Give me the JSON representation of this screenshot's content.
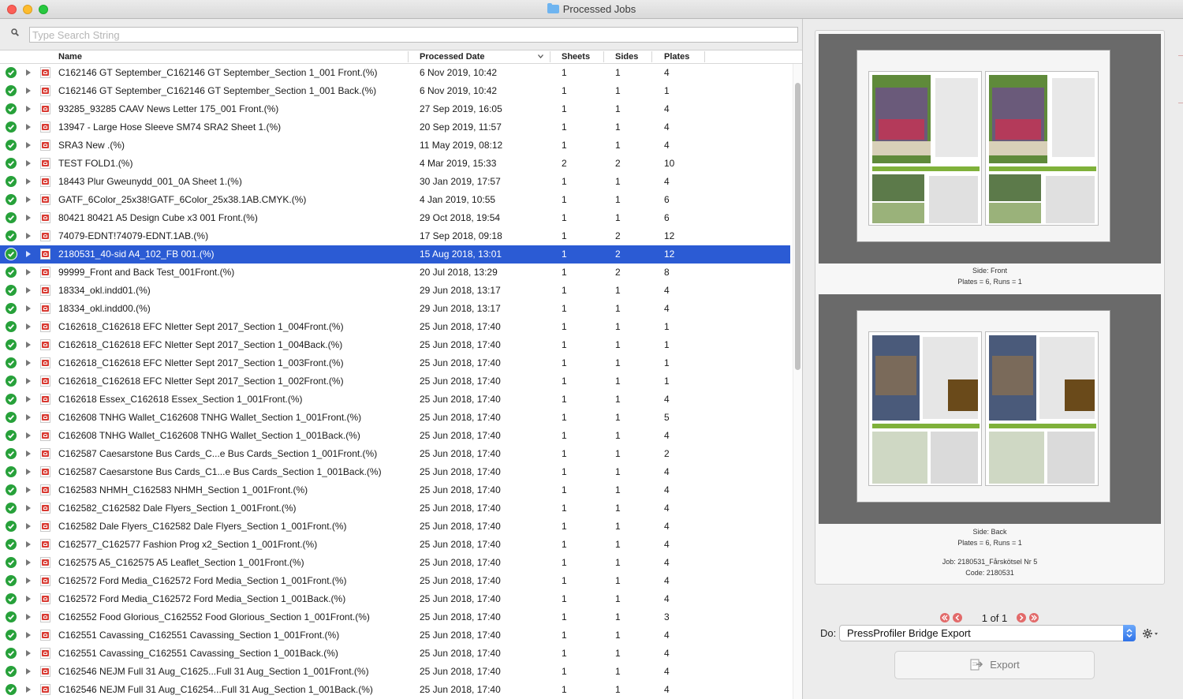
{
  "window": {
    "title": "Processed Jobs"
  },
  "search": {
    "placeholder": "Type Search String",
    "value": ""
  },
  "columns": {
    "name": "Name",
    "date": "Processed Date",
    "sheets": "Sheets",
    "sides": "Sides",
    "plates": "Plates"
  },
  "rows": [
    {
      "name": "C162146 GT September_C162146 GT September_Section 1_001 Front.(%)",
      "date": "6 Nov 2019, 10:42",
      "sheets": "1",
      "sides": "1",
      "plates": "4"
    },
    {
      "name": "C162146 GT September_C162146 GT September_Section 1_001 Back.(%)",
      "date": "6 Nov 2019, 10:42",
      "sheets": "1",
      "sides": "1",
      "plates": "1"
    },
    {
      "name": "93285_93285 CAAV News Letter 175_001 Front.(%)",
      "date": "27 Sep 2019, 16:05",
      "sheets": "1",
      "sides": "1",
      "plates": "4"
    },
    {
      "name": "13947 - Large Hose Sleeve SM74 SRA2 Sheet 1.(%)",
      "date": "20 Sep 2019, 11:57",
      "sheets": "1",
      "sides": "1",
      "plates": "4"
    },
    {
      "name": "SRA3 New .(%)",
      "date": "11 May 2019, 08:12",
      "sheets": "1",
      "sides": "1",
      "plates": "4"
    },
    {
      "name": "TEST  FOLD1.(%)",
      "date": "4 Mar 2019, 15:33",
      "sheets": "2",
      "sides": "2",
      "plates": "10"
    },
    {
      "name": "18443 Plur Gweunydd_001_0A Sheet 1.(%)",
      "date": "30 Jan 2019, 17:57",
      "sheets": "1",
      "sides": "1",
      "plates": "4"
    },
    {
      "name": "GATF_6Color_25x38!GATF_6Color_25x38.1AB.CMYK.(%)",
      "date": "4 Jan 2019, 10:55",
      "sheets": "1",
      "sides": "1",
      "plates": "6"
    },
    {
      "name": "80421 80421 A5 Design Cube x3 001 Front.(%)",
      "date": "29 Oct 2018, 19:54",
      "sheets": "1",
      "sides": "1",
      "plates": "6"
    },
    {
      "name": "74079-EDNT!74079-EDNT.1AB.(%)",
      "date": "17 Sep 2018, 09:18",
      "sheets": "1",
      "sides": "2",
      "plates": "12"
    },
    {
      "name": "2180531_40-sid A4_102_FB 001.(%)",
      "date": "15 Aug 2018, 13:01",
      "sheets": "1",
      "sides": "2",
      "plates": "12",
      "selected": true
    },
    {
      "name": "99999_Front and Back Test_001Front.(%)",
      "date": "20 Jul 2018, 13:29",
      "sheets": "1",
      "sides": "2",
      "plates": "8"
    },
    {
      "name": "18334_okl.indd01.(%)",
      "date": "29 Jun 2018, 13:17",
      "sheets": "1",
      "sides": "1",
      "plates": "4"
    },
    {
      "name": "18334_okl.indd00.(%)",
      "date": "29 Jun 2018, 13:17",
      "sheets": "1",
      "sides": "1",
      "plates": "4"
    },
    {
      "name": "C162618_C162618 EFC Nletter Sept 2017_Section 1_004Front.(%)",
      "date": "25 Jun 2018, 17:40",
      "sheets": "1",
      "sides": "1",
      "plates": "1"
    },
    {
      "name": "C162618_C162618 EFC Nletter Sept 2017_Section 1_004Back.(%)",
      "date": "25 Jun 2018, 17:40",
      "sheets": "1",
      "sides": "1",
      "plates": "1"
    },
    {
      "name": "C162618_C162618 EFC Nletter Sept 2017_Section 1_003Front.(%)",
      "date": "25 Jun 2018, 17:40",
      "sheets": "1",
      "sides": "1",
      "plates": "1"
    },
    {
      "name": "C162618_C162618 EFC Nletter Sept 2017_Section 1_002Front.(%)",
      "date": "25 Jun 2018, 17:40",
      "sheets": "1",
      "sides": "1",
      "plates": "1"
    },
    {
      "name": "C162618 Essex_C162618 Essex_Section 1_001Front.(%)",
      "date": "25 Jun 2018, 17:40",
      "sheets": "1",
      "sides": "1",
      "plates": "4"
    },
    {
      "name": "C162608 TNHG Wallet_C162608 TNHG Wallet_Section 1_001Front.(%)",
      "date": "25 Jun 2018, 17:40",
      "sheets": "1",
      "sides": "1",
      "plates": "5"
    },
    {
      "name": "C162608 TNHG Wallet_C162608 TNHG Wallet_Section 1_001Back.(%)",
      "date": "25 Jun 2018, 17:40",
      "sheets": "1",
      "sides": "1",
      "plates": "4"
    },
    {
      "name": "C162587 Caesarstone Bus Cards_C...e Bus Cards_Section 1_001Front.(%)",
      "date": "25 Jun 2018, 17:40",
      "sheets": "1",
      "sides": "1",
      "plates": "2"
    },
    {
      "name": "C162587 Caesarstone Bus Cards_C1...e Bus Cards_Section 1_001Back.(%)",
      "date": "25 Jun 2018, 17:40",
      "sheets": "1",
      "sides": "1",
      "plates": "4"
    },
    {
      "name": "C162583 NHMH_C162583 NHMH_Section 1_001Front.(%)",
      "date": "25 Jun 2018, 17:40",
      "sheets": "1",
      "sides": "1",
      "plates": "4"
    },
    {
      "name": "C162582_C162582 Dale Flyers_Section 1_001Front.(%)",
      "date": "25 Jun 2018, 17:40",
      "sheets": "1",
      "sides": "1",
      "plates": "4"
    },
    {
      "name": "C162582 Dale Flyers_C162582 Dale Flyers_Section 1_001Front.(%)",
      "date": "25 Jun 2018, 17:40",
      "sheets": "1",
      "sides": "1",
      "plates": "4"
    },
    {
      "name": "C162577_C162577 Fashion Prog x2_Section 1_001Front.(%)",
      "date": "25 Jun 2018, 17:40",
      "sheets": "1",
      "sides": "1",
      "plates": "4"
    },
    {
      "name": "C162575 A5_C162575 A5 Leaflet_Section 1_001Front.(%)",
      "date": "25 Jun 2018, 17:40",
      "sheets": "1",
      "sides": "1",
      "plates": "4"
    },
    {
      "name": "C162572 Ford Media_C162572 Ford Media_Section 1_001Front.(%)",
      "date": "25 Jun 2018, 17:40",
      "sheets": "1",
      "sides": "1",
      "plates": "4"
    },
    {
      "name": "C162572 Ford Media_C162572 Ford Media_Section 1_001Back.(%)",
      "date": "25 Jun 2018, 17:40",
      "sheets": "1",
      "sides": "1",
      "plates": "4"
    },
    {
      "name": "C162552 Food Glorious_C162552 Food Glorious_Section 1_001Front.(%)",
      "date": "25 Jun 2018, 17:40",
      "sheets": "1",
      "sides": "1",
      "plates": "3"
    },
    {
      "name": "C162551 Cavassing_C162551 Cavassing_Section 1_001Front.(%)",
      "date": "25 Jun 2018, 17:40",
      "sheets": "1",
      "sides": "1",
      "plates": "4"
    },
    {
      "name": "C162551 Cavassing_C162551 Cavassing_Section 1_001Back.(%)",
      "date": "25 Jun 2018, 17:40",
      "sheets": "1",
      "sides": "1",
      "plates": "4"
    },
    {
      "name": "C162546 NEJM Full 31 Aug_C1625...Full 31 Aug_Section 1_001Front.(%)",
      "date": "25 Jun 2018, 17:40",
      "sheets": "1",
      "sides": "1",
      "plates": "4"
    },
    {
      "name": "C162546 NEJM Full 31 Aug_C16254...Full 31 Aug_Section 1_001Back.(%)",
      "date": "25 Jun 2018, 17:40",
      "sheets": "1",
      "sides": "1",
      "plates": "4"
    }
  ],
  "preview": {
    "front": {
      "side": "Side: Front",
      "plates_runs": "Plates = 6, Runs = 1"
    },
    "back": {
      "side": "Side: Back",
      "plates_runs": "Plates = 6, Runs = 1"
    },
    "job": "Job: 2180531_Fårskötsel Nr 5",
    "code": "Code: 2180531"
  },
  "pager": {
    "text": "1 of 1"
  },
  "action": {
    "label": "Do:",
    "selected": "PressProfiler Bridge Export"
  },
  "export": {
    "label": "Export"
  },
  "colors": {
    "selection": "#2b5bd4",
    "status_ok": "#27a13a",
    "pager_button": "#e26a6a"
  },
  "icons": {
    "status": "check-circle-icon",
    "file": "pdf-file-icon",
    "expand": "disclosure-triangle-icon",
    "search": "magnifier-icon",
    "folder": "folder-icon",
    "settings": "gear-icon"
  }
}
